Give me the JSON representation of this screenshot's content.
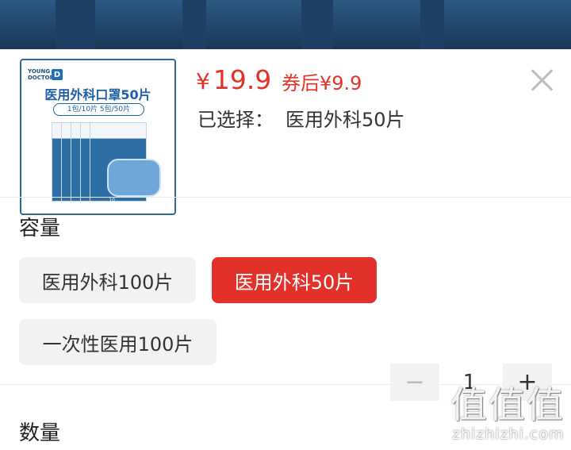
{
  "product": {
    "image": {
      "brand_line1": "YOUNG",
      "brand_line2": "DOCTOR",
      "brand_mark": "D",
      "title": "医用外科口罩50片",
      "spec": "1包/10片 5包/50片",
      "count": "10"
    },
    "price_symbol": "¥",
    "price": "19.9",
    "coupon_price": "券后¥9.9",
    "selected_label": "已选择：",
    "selected_value": "医用外科50片"
  },
  "capacity": {
    "title": "容量",
    "options": [
      {
        "label": "医用外科100片",
        "selected": false
      },
      {
        "label": "医用外科50片",
        "selected": true
      },
      {
        "label": "一次性医用100片",
        "selected": false
      }
    ]
  },
  "quantity": {
    "title": "数量",
    "minus": "−",
    "value": "1",
    "plus": "+"
  },
  "watermark": {
    "glyphs": "值值值",
    "url": "zhizhizhi.com"
  },
  "colors": {
    "accent": "#e2302a",
    "price": "#e53228",
    "option_bg": "#f2f2f2",
    "backdrop": "#1c3f63"
  },
  "icons": {
    "close": "close-icon",
    "logo": "brand-logo-icon"
  }
}
